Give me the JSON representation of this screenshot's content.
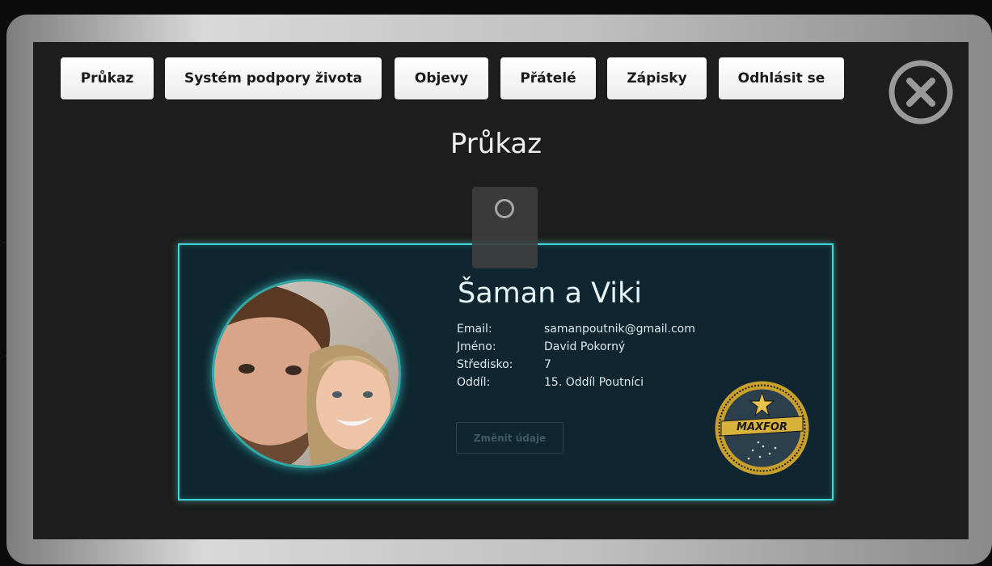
{
  "nav": {
    "tabs": [
      {
        "label": "Průkaz"
      },
      {
        "label": "Systém podpory života"
      },
      {
        "label": "Objevy"
      },
      {
        "label": "Přátelé"
      },
      {
        "label": "Zápisky"
      },
      {
        "label": "Odhlásit se"
      }
    ],
    "close_icon": "close-circle-icon"
  },
  "page": {
    "title": "Průkaz"
  },
  "loading": {
    "icon": "spinner-icon"
  },
  "profile": {
    "display_name": "Šaman a Viki",
    "fields": [
      {
        "label": "Email:",
        "value": "samanpoutnik@gmail.com"
      },
      {
        "label": "Jméno:",
        "value": "David Pokorný"
      },
      {
        "label": "Středisko:",
        "value": "7"
      },
      {
        "label": "Oddíl:",
        "value": "15. Oddíl Poutníci"
      }
    ],
    "edit_button": "Změnit údaje",
    "badge_text": "MAXFOR",
    "avatar": "profile-photo"
  },
  "colors": {
    "accent": "#3fd6d6",
    "card_bg": "#0f2630",
    "panel_bg": "#1e1e1e",
    "badge_gold": "#d8b23a"
  }
}
